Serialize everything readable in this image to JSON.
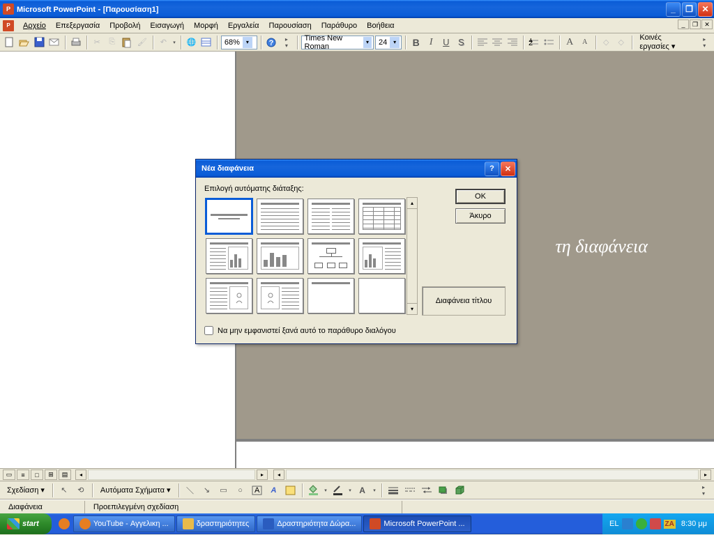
{
  "titlebar": {
    "app": "Microsoft PowerPoint",
    "doc": "[Παρουσίαση1]"
  },
  "menus": [
    "Αρχείο",
    "Επεξεργασία",
    "Προβολή",
    "Εισαγωγή",
    "Μορφή",
    "Εργαλεία",
    "Παρουσίαση",
    "Παράθυρο",
    "Βοήθεια"
  ],
  "toolbar": {
    "zoom": "68%",
    "font": "Times New Roman",
    "fontsize": "24",
    "tasks_label": "Κοινές εργασίες"
  },
  "slide": {
    "placeholder_text": "τη διαφάνεια"
  },
  "drawbar": {
    "drawing": "Σχεδίαση",
    "autoshapes": "Αυτόματα Σχήματα"
  },
  "statusbar": {
    "left": "Διαφάνεια",
    "right": "Προεπιλεγμένη σχεδίαση"
  },
  "dialog": {
    "title": "Νέα διαφάνεια",
    "label": "Επιλογή αυτόματης διάταξης:",
    "ok": "OK",
    "cancel": "Άκυρο",
    "preview": "Διαφάνεια τίτλου",
    "checkbox": "Να μην εμφανιστεί ξανά αυτό το παράθυρο διαλόγου"
  },
  "taskbar": {
    "start": "start",
    "items": [
      "YouTube - Αγγελικη ...",
      "δραστηριότητες",
      "Δραστηριότητα Δώρα...",
      "Microsoft PowerPoint ..."
    ],
    "lang": "EL",
    "ime": "ZA",
    "clock": "8:30 μμ"
  }
}
